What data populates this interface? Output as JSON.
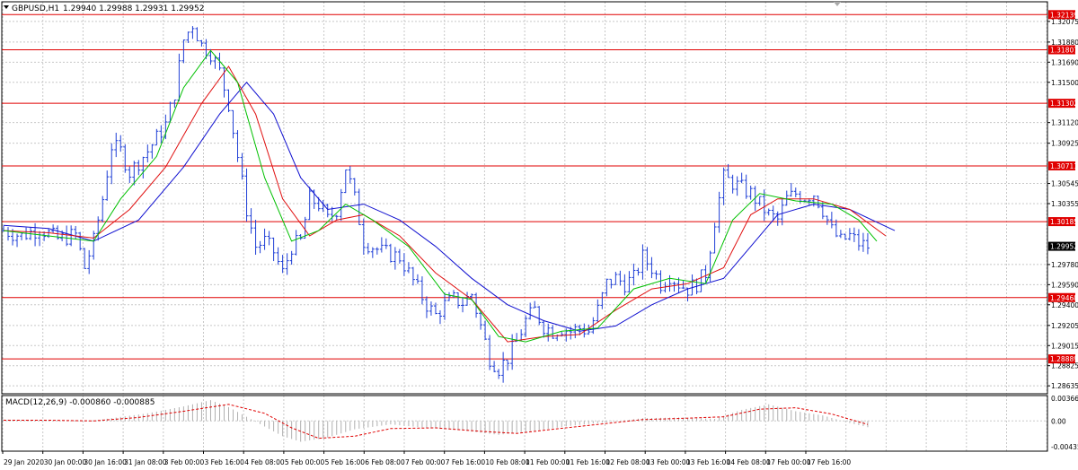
{
  "window": {
    "symbol_label": "GBPUSD,H1",
    "ohlc_label": "1.29940 1.29988 1.29931 1.29952",
    "indicator_label": "MACD(12,26,9) -0.000860 -0.000885"
  },
  "colors": {
    "background": "#ffffff",
    "grid": "#c8c8c8",
    "candles": "#1f3fd6",
    "ma_fast": "#00c000",
    "ma_mid": "#e01010",
    "ma_slow": "#1010d0",
    "level_line": "#e00000",
    "level_tag_bg": "#e00000",
    "current_tag_bg": "#000000",
    "macd_hist": "#b0b0b0",
    "macd_signal": "#e00000",
    "axis_text": "#000000"
  },
  "chart_data": [
    {
      "type": "line",
      "name": "price",
      "ylim": [
        1.2856,
        1.3226
      ],
      "x_ticks": [
        "29 Jan 2020",
        "30 Jan 00:00",
        "30 Jan 16:00",
        "31 Jan 08:00",
        "3 Feb 00:00",
        "3 Feb 16:00",
        "4 Feb 08:00",
        "5 Feb 00:00",
        "5 Feb 16:00",
        "6 Feb 08:00",
        "7 Feb 00:00",
        "7 Feb 16:00",
        "10 Feb 08:00",
        "11 Feb 00:00",
        "11 Feb 16:00",
        "12 Feb 08:00",
        "13 Feb 00:00",
        "13 Feb 16:00",
        "14 Feb 08:00",
        "17 Feb 00:00",
        "17 Feb 16:00"
      ],
      "y_ticks": [
        "1.32075",
        "1.31880",
        "1.31690",
        "1.31500",
        "1.31120",
        "1.30925",
        "1.30545",
        "1.30355",
        "1.29780",
        "1.29590",
        "1.29400",
        "1.29205",
        "1.29015",
        "1.28825",
        "1.28635"
      ],
      "y_tick_values": [
        1.32075,
        1.3188,
        1.3169,
        1.315,
        1.3112,
        1.30925,
        1.30545,
        1.30355,
        1.2978,
        1.2959,
        1.294,
        1.29205,
        1.29015,
        1.28825,
        1.28635
      ],
      "levels": [
        {
          "label": "1.32139",
          "value": 1.32139
        },
        {
          "label": "1.31807",
          "value": 1.31807
        },
        {
          "label": "1.31302",
          "value": 1.31302
        },
        {
          "label": "1.30711",
          "value": 1.30711
        },
        {
          "label": "1.30185",
          "value": 1.30185
        },
        {
          "label": "1.29468",
          "value": 1.29468
        },
        {
          "label": "1.28889",
          "value": 1.28889
        }
      ],
      "current_price": {
        "label": "1.29952",
        "value": 1.29952
      },
      "price_path": [
        [
          0,
          1.301
        ],
        [
          4,
          1.3005
        ],
        [
          8,
          1.3012
        ],
        [
          12,
          1.3002
        ],
        [
          16,
          1.3006
        ],
        [
          18,
          1.2975
        ],
        [
          20,
          1.3
        ],
        [
          22,
          1.304
        ],
        [
          24,
          1.309
        ],
        [
          26,
          1.3085
        ],
        [
          28,
          1.3065
        ],
        [
          32,
          1.3085
        ],
        [
          36,
          1.311
        ],
        [
          38,
          1.314
        ],
        [
          40,
          1.319
        ],
        [
          42,
          1.3205
        ],
        [
          44,
          1.3185
        ],
        [
          46,
          1.3178
        ],
        [
          48,
          1.316
        ],
        [
          50,
          1.313
        ],
        [
          52,
          1.308
        ],
        [
          54,
          1.303
        ],
        [
          56,
          1.2995
        ],
        [
          58,
          1.3
        ],
        [
          60,
          1.299
        ],
        [
          62,
          1.297
        ],
        [
          64,
          1.2995
        ],
        [
          66,
          1.3
        ],
        [
          68,
          1.304
        ],
        [
          70,
          1.3035
        ],
        [
          72,
          1.302
        ],
        [
          74,
          1.303
        ],
        [
          76,
          1.307
        ],
        [
          78,
          1.304
        ],
        [
          80,
          1.3
        ],
        [
          84,
          1.299
        ],
        [
          88,
          1.2985
        ],
        [
          90,
          1.297
        ],
        [
          92,
          1.2955
        ],
        [
          94,
          1.294
        ],
        [
          96,
          1.293
        ],
        [
          98,
          1.294
        ],
        [
          100,
          1.2945
        ],
        [
          102,
          1.2942
        ],
        [
          104,
          1.295
        ],
        [
          106,
          1.292
        ],
        [
          108,
          1.289
        ],
        [
          110,
          1.288
        ],
        [
          112,
          1.289
        ],
        [
          114,
          1.2905
        ],
        [
          116,
          1.2925
        ],
        [
          118,
          1.2935
        ],
        [
          120,
          1.292
        ],
        [
          122,
          1.2915
        ],
        [
          124,
          1.2918
        ],
        [
          126,
          1.2915
        ],
        [
          128,
          1.2918
        ],
        [
          130,
          1.2915
        ],
        [
          132,
          1.2935
        ],
        [
          134,
          1.296
        ],
        [
          136,
          1.2965
        ],
        [
          138,
          1.296
        ],
        [
          140,
          1.2965
        ],
        [
          142,
          1.2985
        ],
        [
          144,
          1.2975
        ],
        [
          146,
          1.296
        ],
        [
          148,
          1.2968
        ],
        [
          150,
          1.296
        ],
        [
          152,
          1.2955
        ],
        [
          154,
          1.296
        ],
        [
          156,
          1.297
        ],
        [
          158,
          1.302
        ],
        [
          160,
          1.306
        ],
        [
          162,
          1.3055
        ],
        [
          164,
          1.305
        ],
        [
          166,
          1.3045
        ],
        [
          168,
          1.3035
        ],
        [
          170,
          1.3025
        ],
        [
          172,
          1.302
        ],
        [
          174,
          1.304
        ],
        [
          176,
          1.3045
        ],
        [
          178,
          1.3042
        ],
        [
          180,
          1.3045
        ],
        [
          182,
          1.303
        ],
        [
          184,
          1.301
        ],
        [
          186,
          1.3
        ],
        [
          188,
          1.3005
        ],
        [
          190,
          1.2998
        ],
        [
          192,
          1.29952
        ]
      ],
      "ma_fast_path": [
        [
          0,
          1.301
        ],
        [
          10,
          1.3005
        ],
        [
          20,
          1.3
        ],
        [
          26,
          1.304
        ],
        [
          34,
          1.308
        ],
        [
          40,
          1.3145
        ],
        [
          46,
          1.318
        ],
        [
          52,
          1.315
        ],
        [
          58,
          1.306
        ],
        [
          64,
          1.3
        ],
        [
          70,
          1.301
        ],
        [
          76,
          1.3035
        ],
        [
          82,
          1.302
        ],
        [
          90,
          1.2995
        ],
        [
          98,
          1.295
        ],
        [
          104,
          1.2945
        ],
        [
          110,
          1.291
        ],
        [
          116,
          1.2905
        ],
        [
          124,
          1.2915
        ],
        [
          132,
          1.2918
        ],
        [
          140,
          1.2955
        ],
        [
          148,
          1.2965
        ],
        [
          156,
          1.296
        ],
        [
          162,
          1.302
        ],
        [
          168,
          1.3045
        ],
        [
          176,
          1.3038
        ],
        [
          184,
          1.3035
        ],
        [
          190,
          1.302
        ],
        [
          194,
          1.3
        ]
      ],
      "ma_mid_path": [
        [
          0,
          1.301
        ],
        [
          10,
          1.3008
        ],
        [
          20,
          1.3003
        ],
        [
          28,
          1.303
        ],
        [
          36,
          1.307
        ],
        [
          44,
          1.313
        ],
        [
          50,
          1.3165
        ],
        [
          56,
          1.312
        ],
        [
          62,
          1.304
        ],
        [
          68,
          1.3005
        ],
        [
          74,
          1.302
        ],
        [
          80,
          1.3025
        ],
        [
          88,
          1.3005
        ],
        [
          96,
          1.297
        ],
        [
          104,
          1.2945
        ],
        [
          112,
          1.2905
        ],
        [
          120,
          1.291
        ],
        [
          128,
          1.2912
        ],
        [
          136,
          1.2935
        ],
        [
          144,
          1.2955
        ],
        [
          152,
          1.296
        ],
        [
          160,
          1.2975
        ],
        [
          166,
          1.3025
        ],
        [
          172,
          1.304
        ],
        [
          180,
          1.304
        ],
        [
          188,
          1.303
        ],
        [
          196,
          1.3005
        ]
      ],
      "ma_slow_path": [
        [
          0,
          1.3015
        ],
        [
          10,
          1.3012
        ],
        [
          20,
          1.3
        ],
        [
          30,
          1.302
        ],
        [
          40,
          1.307
        ],
        [
          48,
          1.312
        ],
        [
          54,
          1.315
        ],
        [
          60,
          1.312
        ],
        [
          66,
          1.306
        ],
        [
          72,
          1.303
        ],
        [
          80,
          1.3035
        ],
        [
          88,
          1.302
        ],
        [
          96,
          1.2995
        ],
        [
          104,
          1.2965
        ],
        [
          112,
          1.294
        ],
        [
          120,
          1.2925
        ],
        [
          128,
          1.2915
        ],
        [
          136,
          1.292
        ],
        [
          144,
          1.294
        ],
        [
          152,
          1.2955
        ],
        [
          160,
          1.2965
        ],
        [
          166,
          1.2995
        ],
        [
          172,
          1.3025
        ],
        [
          180,
          1.3035
        ],
        [
          188,
          1.303
        ],
        [
          198,
          1.301
        ]
      ]
    },
    {
      "type": "bar",
      "name": "MACD(12,26,9)",
      "ylim": [
        -0.004358,
        0.003662
      ],
      "y_ticks": [
        "0.003662",
        "0.00",
        "-0.004358"
      ],
      "y_tick_values": [
        0.003662,
        0.0,
        -0.004358
      ],
      "hist_path": [
        [
          0,
          0.0002
        ],
        [
          10,
          0.0001
        ],
        [
          18,
          -0.0001
        ],
        [
          24,
          0.0004
        ],
        [
          32,
          0.0011
        ],
        [
          40,
          0.0021
        ],
        [
          46,
          0.003
        ],
        [
          50,
          0.002
        ],
        [
          56,
          -0.0001
        ],
        [
          62,
          -0.0022
        ],
        [
          66,
          -0.003
        ],
        [
          72,
          -0.0024
        ],
        [
          78,
          -0.0012
        ],
        [
          86,
          -0.0005
        ],
        [
          94,
          -0.001
        ],
        [
          102,
          -0.0014
        ],
        [
          110,
          -0.002
        ],
        [
          118,
          -0.0014
        ],
        [
          126,
          -0.0007
        ],
        [
          134,
          -0.0002
        ],
        [
          142,
          0.0004
        ],
        [
          150,
          0.0005
        ],
        [
          158,
          0.0003
        ],
        [
          164,
          0.0016
        ],
        [
          170,
          0.0024
        ],
        [
          176,
          0.0014
        ],
        [
          182,
          0.0008
        ],
        [
          188,
          -0.0003
        ],
        [
          192,
          -0.0009
        ]
      ],
      "signal_path": [
        [
          0,
          0.0001
        ],
        [
          10,
          0.0001
        ],
        [
          20,
          0.0
        ],
        [
          30,
          0.0005
        ],
        [
          40,
          0.0014
        ],
        [
          50,
          0.0024
        ],
        [
          58,
          0.0011
        ],
        [
          64,
          -0.001
        ],
        [
          70,
          -0.0025
        ],
        [
          78,
          -0.0022
        ],
        [
          86,
          -0.0011
        ],
        [
          96,
          -0.001
        ],
        [
          106,
          -0.0015
        ],
        [
          114,
          -0.0018
        ],
        [
          122,
          -0.0012
        ],
        [
          132,
          -0.0005
        ],
        [
          142,
          0.0002
        ],
        [
          152,
          0.0004
        ],
        [
          160,
          0.0006
        ],
        [
          168,
          0.0017
        ],
        [
          176,
          0.0019
        ],
        [
          184,
          0.001
        ],
        [
          192,
          -0.0005
        ]
      ]
    }
  ]
}
